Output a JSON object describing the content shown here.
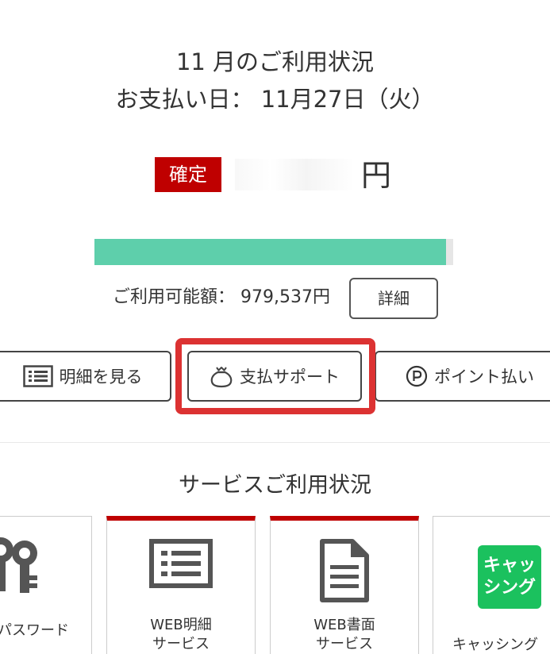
{
  "summary": {
    "title_line1": "11 月のご利用状況",
    "title_line2": "お支払い日： 11月27日（火）",
    "status_badge": "確定",
    "yen_unit": "円",
    "progress_fraction": 0.98,
    "available_credit": "ご利用可能額： 979,537円",
    "detail_button": "詳細"
  },
  "actions": [
    {
      "label": "明細を見る",
      "icon": "list-icon"
    },
    {
      "label": "支払サポート",
      "icon": "money-bag-icon"
    },
    {
      "label": "ポイント払い",
      "icon": "point-icon"
    }
  ],
  "services": {
    "heading": "サービスご利用状況",
    "cards": [
      {
        "label_line1": "パスワード",
        "label_line2": "",
        "icon": "keys-icon"
      },
      {
        "label_line1": "WEB明細",
        "label_line2": "サービス",
        "icon": "statement-icon"
      },
      {
        "label_line1": "WEB書面",
        "label_line2": "サービス",
        "icon": "document-icon"
      },
      {
        "label_line1": "キャッシング",
        "label_line2": "",
        "icon": "cashing-icon",
        "icon_text_line1": "キャッ",
        "icon_text_line2": "シング"
      }
    ]
  },
  "colors": {
    "brand_red": "#bf0000",
    "highlight_red": "#dc3232",
    "progress_green": "#5ecfab",
    "cashing_green": "#1bc15e"
  }
}
